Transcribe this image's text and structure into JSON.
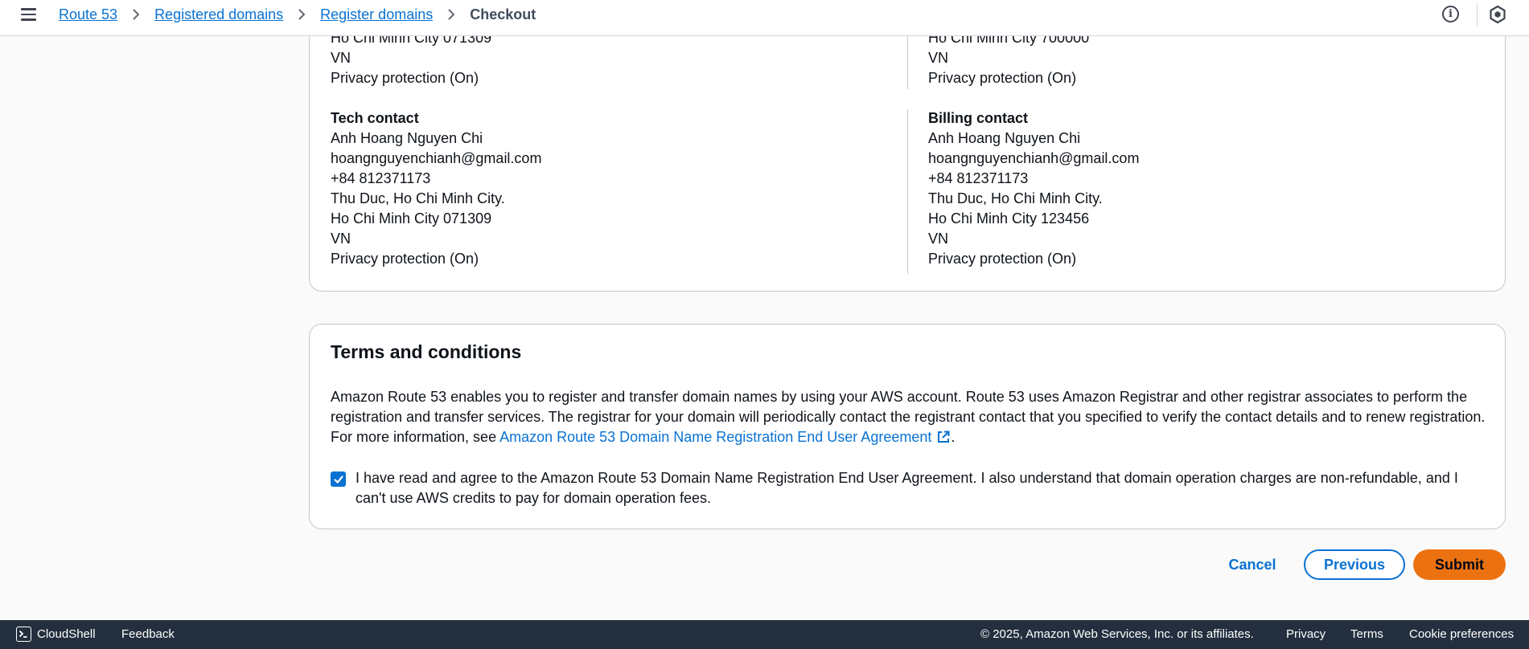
{
  "header": {
    "breadcrumbs": [
      "Route 53",
      "Registered domains",
      "Register domains"
    ],
    "current": "Checkout",
    "info_icon": "i"
  },
  "contacts": {
    "left_partial": [
      "Ho Chi Minh City 071309",
      "VN",
      "Privacy protection (On)"
    ],
    "right_partial": [
      "Ho Chi Minh City 700000",
      "VN",
      "Privacy protection (On)"
    ],
    "tech": {
      "title": "Tech contact",
      "name": "Anh Hoang Nguyen Chi",
      "email": "hoangnguyenchianh@gmail.com",
      "phone": "+84 812371173",
      "address": "Thu Duc, Ho Chi Minh City.",
      "city": "Ho Chi Minh City 071309",
      "country": "VN",
      "privacy": "Privacy protection (On)"
    },
    "billing": {
      "title": "Billing contact",
      "name": "Anh Hoang Nguyen Chi",
      "email": "hoangnguyenchianh@gmail.com",
      "phone": "+84 812371173",
      "address": "Thu Duc, Ho Chi Minh City.",
      "city": "Ho Chi Minh City 123456",
      "country": "VN",
      "privacy": "Privacy protection (On)"
    }
  },
  "terms": {
    "title": "Terms and conditions",
    "body": "Amazon Route 53 enables you to register and transfer domain names by using your AWS account. Route 53 uses Amazon Registrar and other registrar associates to perform the registration and transfer services. The registrar for your domain will periodically contact the registrant contact that you specified to verify the contact details and to renew registration. For more information, see ",
    "link": "Amazon Route 53 Domain Name Registration End User Agreement",
    "period": ".",
    "agree_label": "I have read and agree to the Amazon Route 53 Domain Name Registration End User Agreement. I also understand that domain operation charges are non-refundable, and I can't use AWS credits to pay for domain operation fees.",
    "agree_checked": true
  },
  "actions": {
    "cancel": "Cancel",
    "previous": "Previous",
    "submit": "Submit"
  },
  "footer": {
    "cloudshell": "CloudShell",
    "feedback": "Feedback",
    "copyright": "© 2025, Amazon Web Services, Inc. or its affiliates.",
    "privacy": "Privacy",
    "terms": "Terms",
    "cookies": "Cookie preferences"
  },
  "colors": {
    "link": "#0972d3",
    "submit": "#ec7211",
    "footer_bg": "#232f3e"
  }
}
